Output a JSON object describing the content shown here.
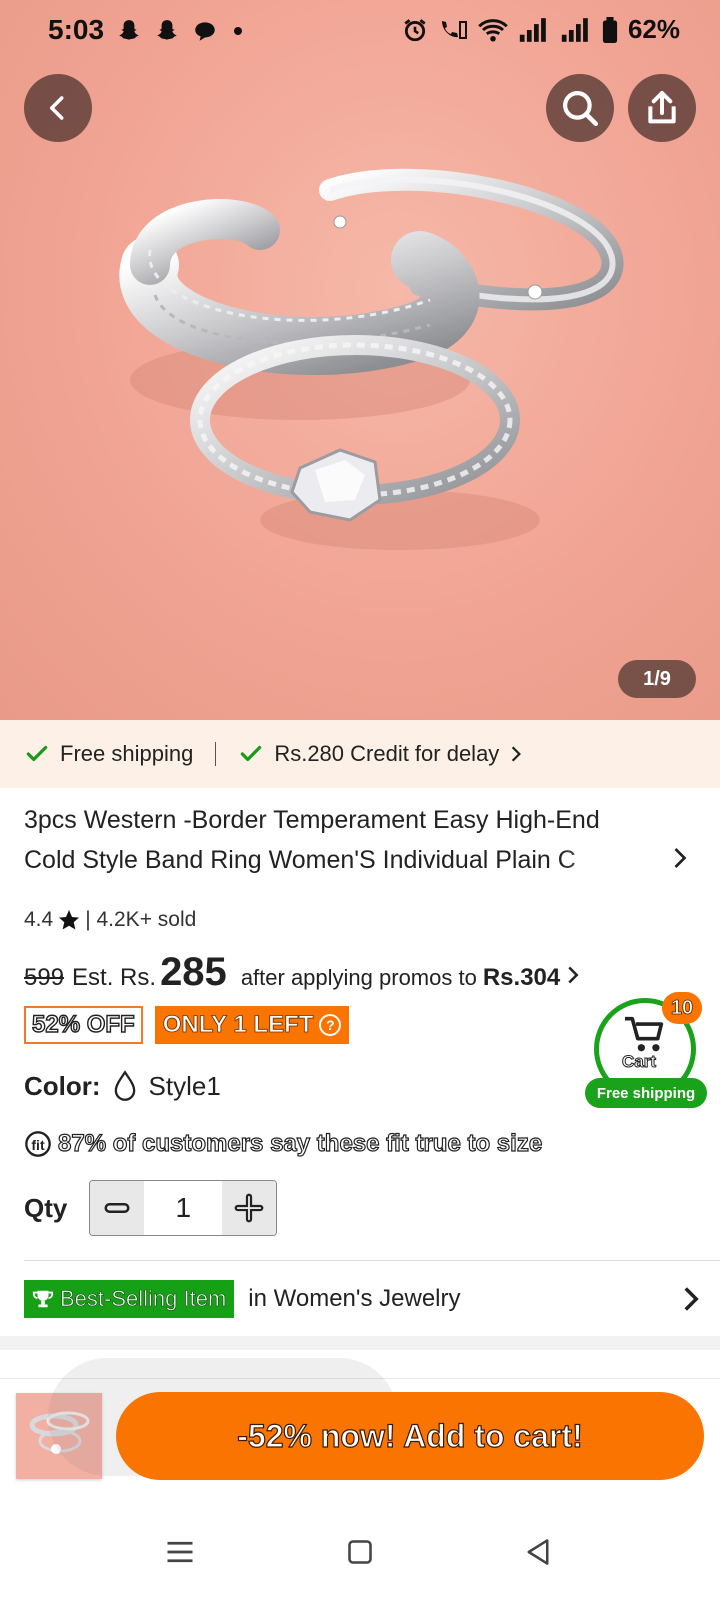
{
  "status_bar": {
    "time": "5:03",
    "battery": "62%",
    "icons": [
      "snapchat-icon",
      "snapchat-icon",
      "chat-icon",
      "dot-icon",
      "alarm-icon",
      "volte-call-icon",
      "wifi-icon",
      "signal-icon",
      "signal-icon",
      "battery-icon"
    ]
  },
  "header": {
    "back_icon": "chevron-left-icon",
    "search_icon": "search-icon",
    "share_icon": "share-icon"
  },
  "gallery": {
    "indicator": "1/9"
  },
  "shipping": {
    "free_shipping": "Free shipping",
    "credit": "Rs.280 Credit for delay"
  },
  "product": {
    "title": "3pcs Western -Border Temperament Easy High-End Cold Style Band Ring Women'S Individual Plain C",
    "rating": "4.4",
    "sold": "| 4.2K+ sold",
    "old_price": "599",
    "est_label": "Est. Rs.",
    "est_price": "285",
    "after_promo": "after applying promos to",
    "promo_price": "Rs.304",
    "discount_badge": "52% OFF",
    "stock_badge": "ONLY 1 LEFT",
    "color_label": "Color:",
    "color_value": "Style1",
    "fit_text": "87% of customers say these fit true to size",
    "qty_label": "Qty",
    "qty_value": "1",
    "best_badge": "Best-Selling Item",
    "best_category": "in Women's Jewelry"
  },
  "floating_cart": {
    "count": "10",
    "label": "Cart",
    "shipping": "Free shipping"
  },
  "bottom_bar": {
    "add_to_cart": "-52% now! Add to cart!"
  },
  "colors": {
    "accent_orange": "#f97400",
    "green": "#16a016",
    "hero_bg": "#f1a494"
  }
}
